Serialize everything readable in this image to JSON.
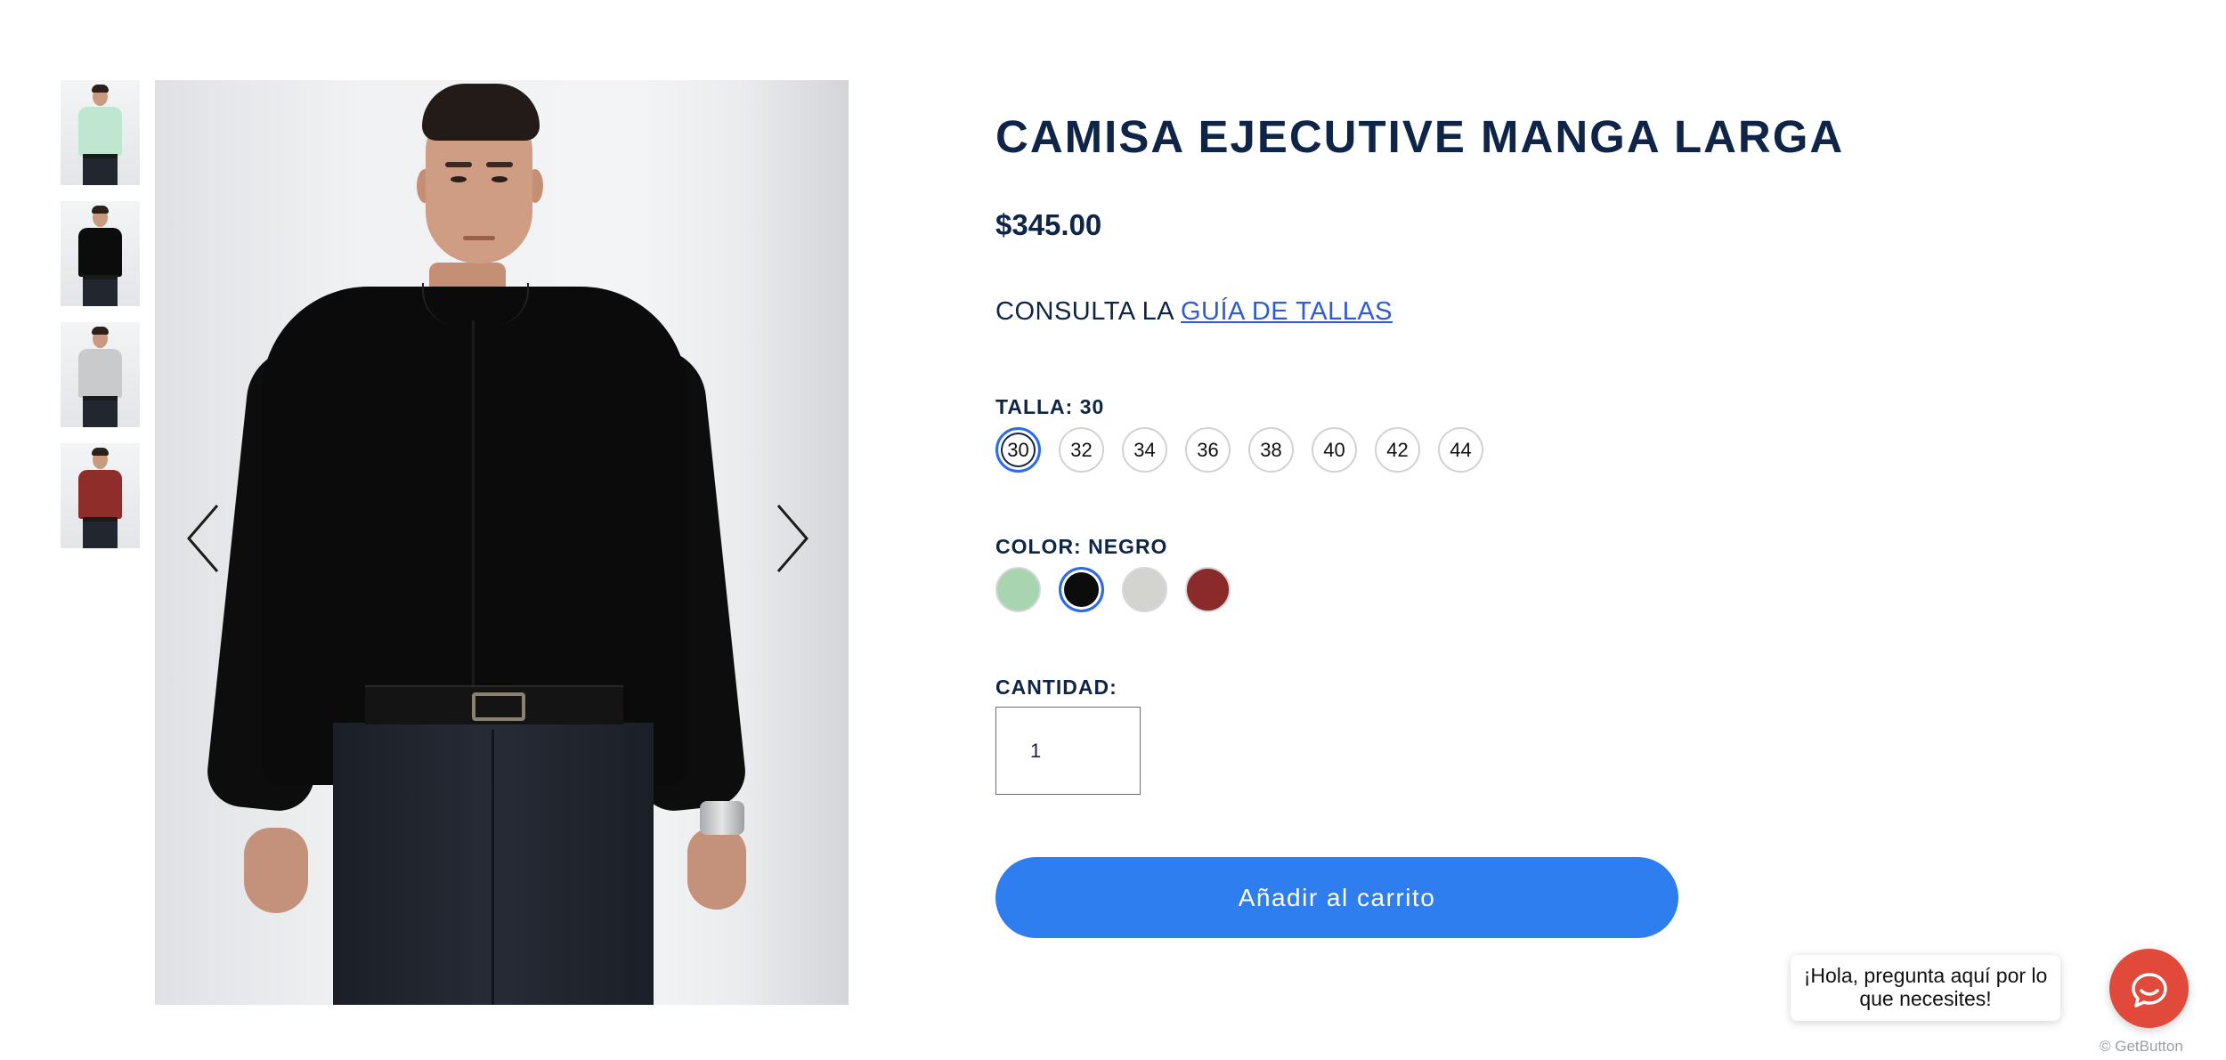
{
  "product": {
    "title": "CAMISA EJECUTIVE MANGA LARGA",
    "price": "$345.00",
    "size_guide_prefix": "CONSULTA LA ",
    "size_guide_link": "GUÍA DE TALLAS"
  },
  "size": {
    "label": "TALLA: 30",
    "options": [
      "30",
      "32",
      "34",
      "36",
      "38",
      "40",
      "42",
      "44"
    ],
    "selected": "30"
  },
  "color": {
    "label": "COLOR: NEGRO",
    "options": [
      {
        "name": "verde",
        "hex": "#a8d4b0"
      },
      {
        "name": "negro",
        "hex": "#0c0c0d"
      },
      {
        "name": "gris",
        "hex": "#d3d3d0"
      },
      {
        "name": "rojo",
        "hex": "#8a2a2a"
      }
    ],
    "selected": "negro"
  },
  "quantity": {
    "label": "CANTIDAD:",
    "value": "1"
  },
  "add_to_cart": "Añadir al carrito",
  "gallery": {
    "thumbnails": [
      {
        "shirt_color": "#bfe6d0"
      },
      {
        "shirt_color": "#0c0c0d"
      },
      {
        "shirt_color": "#c9cacc"
      },
      {
        "shirt_color": "#8f2d2b"
      }
    ],
    "prev_icon": "chevron-left-icon",
    "next_icon": "chevron-right-icon"
  },
  "chat": {
    "bubble_text": "¡Hola, pregunta aquí por lo que necesites!",
    "brand": "GetButton",
    "button_color": "#e1493a"
  },
  "colors": {
    "accent": "#2f7ef0",
    "title": "#0f2548",
    "link": "#2f5bd8"
  }
}
